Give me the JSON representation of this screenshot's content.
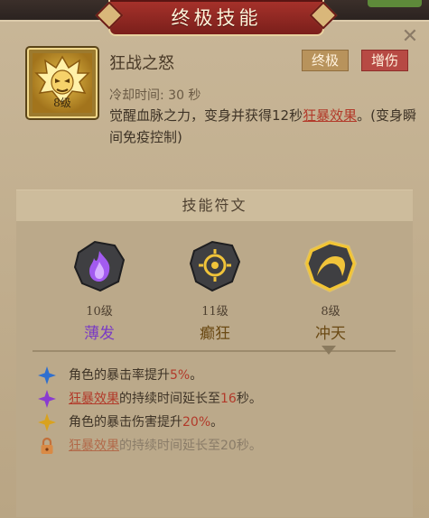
{
  "window": {
    "title": "终极技能",
    "close_label": "✕"
  },
  "skill": {
    "name": "狂战之怒",
    "level_label": "8级",
    "tags": [
      "终极",
      "增伤"
    ],
    "cooldown": "冷却时间: 30 秒",
    "desc_part1": "觉醒血脉之力，变身并获得12秒",
    "desc_link": "狂暴效果",
    "desc_part2": "。(变身瞬间免疫控制)"
  },
  "runes": {
    "header": "技能符文",
    "items": [
      {
        "level": "10级",
        "name": "薄发",
        "name_color": "#7a3bc4",
        "icon": "purple-flame-icon"
      },
      {
        "level": "11级",
        "name": "癫狂",
        "name_color": "#6b4a14",
        "icon": "golden-eye-icon"
      },
      {
        "level": "8级",
        "name": "冲天",
        "name_color": "#6b4a14",
        "icon": "rising-arc-icon"
      }
    ]
  },
  "effects": [
    {
      "icon": "blue-star-icon",
      "text1": "角色的暴击率提升",
      "highlight": "5%",
      "text2": "。"
    },
    {
      "icon": "purple-star-icon",
      "link": "狂暴效果",
      "text1": "的持续时间延长至",
      "highlight": "16",
      "text2": "秒。"
    },
    {
      "icon": "gold-star-icon",
      "text1": "角色的暴击伤害提升",
      "highlight": "20%",
      "text2": "。"
    },
    {
      "icon": "lock-icon",
      "link": "狂暴效果",
      "text1": "的持续时间延长至20秒。"
    }
  ]
}
